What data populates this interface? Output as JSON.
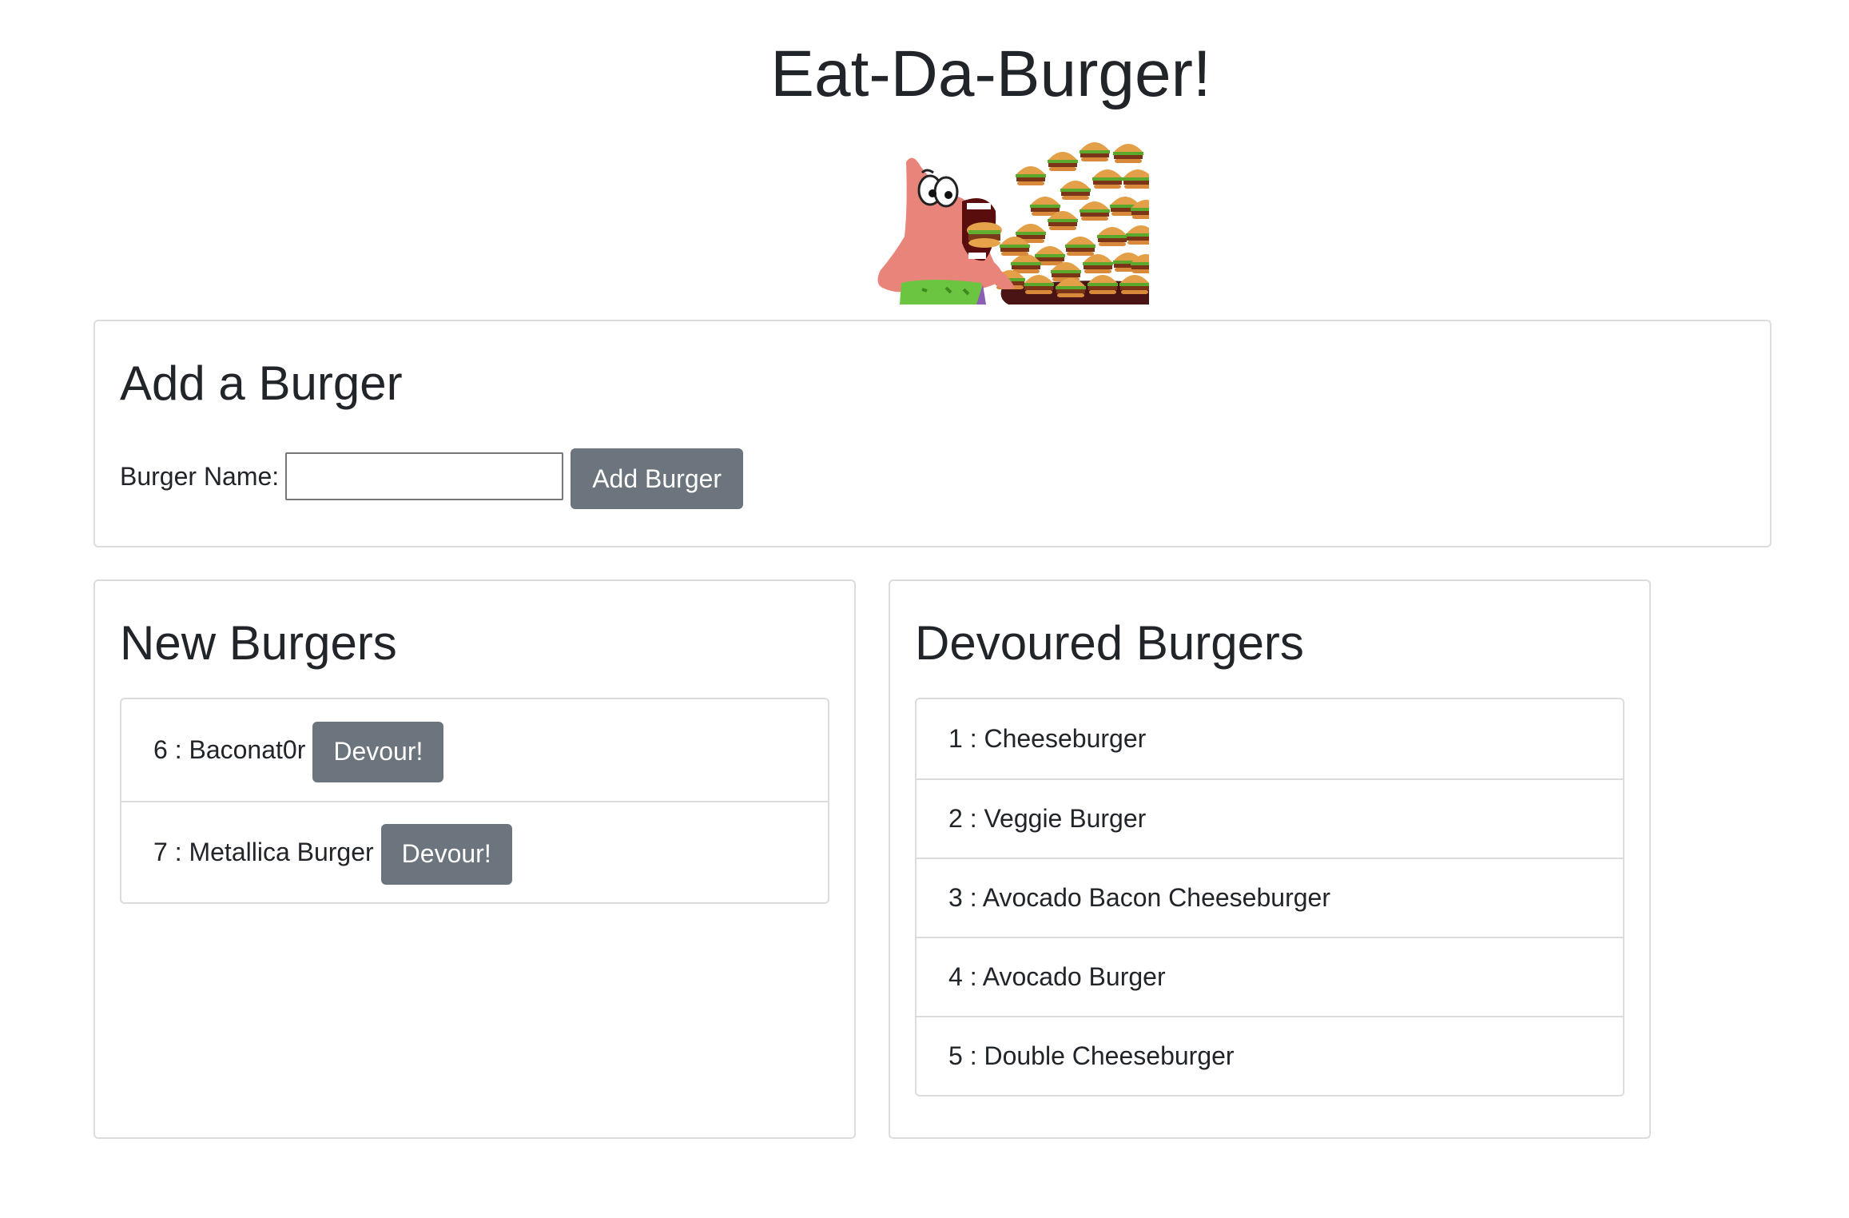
{
  "header": {
    "title": "Eat-Da-Burger!"
  },
  "hero_image": {
    "description_icon": "patrick-eating-burgers-image"
  },
  "add_burger": {
    "heading": "Add a Burger",
    "label": "Burger Name:",
    "input_value": "",
    "input_placeholder": "",
    "button_label": "Add Burger"
  },
  "new_burgers": {
    "heading": "New Burgers",
    "items": [
      {
        "text": "6 : Baconat0r",
        "button": "Devour!"
      },
      {
        "text": "7 : Metallica Burger",
        "button": "Devour!"
      }
    ]
  },
  "devoured_burgers": {
    "heading": "Devoured Burgers",
    "items": [
      {
        "text": "1 : Cheeseburger"
      },
      {
        "text": "2 : Veggie Burger"
      },
      {
        "text": "3 : Avocado Bacon Cheeseburger"
      },
      {
        "text": "4 : Avocado Burger"
      },
      {
        "text": "5 : Double Cheeseburger"
      }
    ]
  },
  "colors": {
    "button_bg": "#6c757d",
    "border": "#dcdcdc",
    "text": "#212529"
  }
}
